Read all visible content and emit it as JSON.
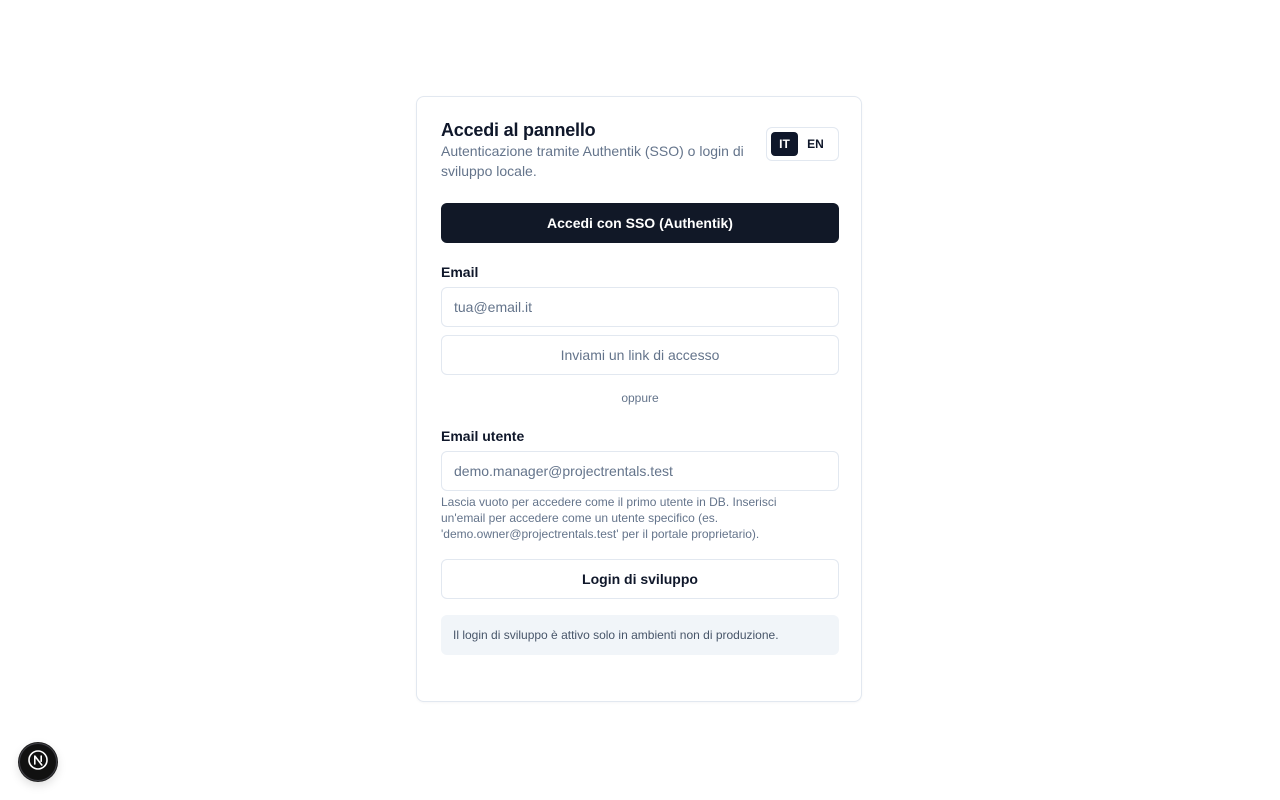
{
  "card": {
    "title": "Accedi al pannello",
    "subtitle": "Autenticazione tramite Authentik (SSO) o login di sviluppo locale."
  },
  "language": {
    "options": [
      "IT",
      "EN"
    ],
    "selected": "IT"
  },
  "sso": {
    "button_label": "Accedi con SSO (Authentik)"
  },
  "magic_link": {
    "email_label": "Email",
    "email_placeholder": "tua@email.it",
    "email_value": "",
    "send_button_label": "Inviami un link di accesso"
  },
  "separator": {
    "text": "oppure"
  },
  "dev_login": {
    "user_email_label": "Email utente",
    "user_email_placeholder": "demo.manager@projectrentals.test",
    "user_email_value": "",
    "hint": "Lascia vuoto per accedere come il primo utente in DB. Inserisci un'email per accedere come un utente specifico (es. 'demo.owner@projectrentals.test' per il portale proprietario).",
    "button_label": "Login di sviluppo",
    "notice": "Il login di sviluppo è attivo solo in ambienti non di produzione."
  },
  "dev_indicator": {
    "icon": "nextjs-icon",
    "letter": "N"
  },
  "colors": {
    "primary": "#111827",
    "muted_text": "#64748b",
    "border": "#e2e8f0",
    "notice_bg": "#f1f5f9"
  }
}
